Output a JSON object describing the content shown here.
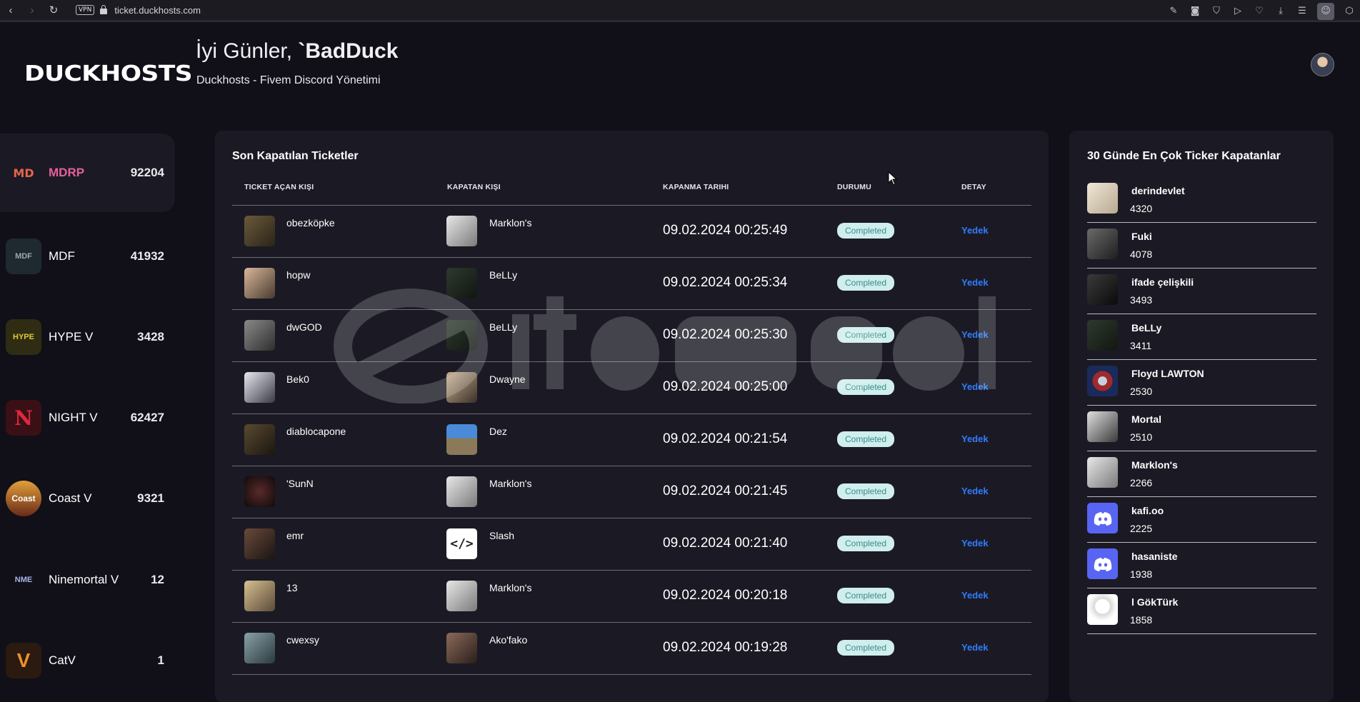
{
  "browser": {
    "vpn_label": "VPN",
    "url": "ticket.duckhosts.com"
  },
  "header": {
    "logo": "DUCKHOSTS",
    "greeting_prefix": "İyi Günler, ",
    "greeting_user": "`BadDuck",
    "subtitle": "Duckhosts - Fivem Discord Yönetimi"
  },
  "sidebar": {
    "servers": [
      {
        "name": "MDRP",
        "count": "92204",
        "icon_text": "MD",
        "color": "#e8634a"
      },
      {
        "name": "MDF",
        "count": "41932",
        "icon_text": "MDF",
        "color": "#4a5a66"
      },
      {
        "name": "HYPE V",
        "count": "3428",
        "icon_text": "HYPE",
        "color": "#c7b23a"
      },
      {
        "name": "NIGHT V",
        "count": "62427",
        "icon_text": "N",
        "color": "#c2263a"
      },
      {
        "name": "Coast V",
        "count": "9321",
        "icon_text": "Coast",
        "color": "#d07a2a"
      },
      {
        "name": "Ninemortal V",
        "count": "12",
        "icon_text": "NME",
        "color": "#8a95c8"
      },
      {
        "name": "CatV",
        "count": "1",
        "icon_text": "V",
        "color": "#e0802a"
      }
    ]
  },
  "tickets": {
    "title": "Son Kapatılan Ticketler",
    "headers": [
      "TICKET AÇAN KIŞI",
      "KAPATAN KIŞI",
      "KAPANMA TARIHI",
      "DURUMU",
      "DETAY"
    ],
    "rows": [
      {
        "opener": "obezköpke",
        "closer": "Marklon's",
        "date": "09.02.2024 00:25:49",
        "status": "Completed",
        "detail": "Yedek"
      },
      {
        "opener": "hopw",
        "closer": "BeLLy",
        "date": "09.02.2024 00:25:34",
        "status": "Completed",
        "detail": "Yedek"
      },
      {
        "opener": "dwGOD",
        "closer": "BeLLy",
        "date": "09.02.2024 00:25:30",
        "status": "Completed",
        "detail": "Yedek"
      },
      {
        "opener": "Bek0",
        "closer": "Dwayne",
        "date": "09.02.2024 00:25:00",
        "status": "Completed",
        "detail": "Yedek"
      },
      {
        "opener": "diablocapone",
        "closer": "Dez",
        "date": "09.02.2024 00:21:54",
        "status": "Completed",
        "detail": "Yedek"
      },
      {
        "opener": "'SunN",
        "closer": "Marklon's",
        "date": "09.02.2024 00:21:45",
        "status": "Completed",
        "detail": "Yedek"
      },
      {
        "opener": "emr",
        "closer": "Slash",
        "date": "09.02.2024 00:21:40",
        "status": "Completed",
        "detail": "Yedek"
      },
      {
        "opener": "13",
        "closer": "Marklon's",
        "date": "09.02.2024 00:20:18",
        "status": "Completed",
        "detail": "Yedek"
      },
      {
        "opener": "cwexsy",
        "closer": "Ako'fako",
        "date": "09.02.2024 00:19:28",
        "status": "Completed",
        "detail": "Yedek"
      }
    ]
  },
  "leaderboard": {
    "title": "30 Günde En Çok Ticker Kapatanlar",
    "items": [
      {
        "name": "derindevlet",
        "count": "4320"
      },
      {
        "name": "Fuki",
        "count": "4078"
      },
      {
        "name": "ifade çelişkili",
        "count": "3493"
      },
      {
        "name": "BeLLy",
        "count": "3411"
      },
      {
        "name": "Floyd LAWTON",
        "count": "2530"
      },
      {
        "name": "Mortal",
        "count": "2510"
      },
      {
        "name": "Marklon's",
        "count": "2266"
      },
      {
        "name": "kafi.oo",
        "count": "2225"
      },
      {
        "name": "hasaniste",
        "count": "1938"
      },
      {
        "name": "l GökTürk",
        "count": "1858"
      }
    ]
  }
}
